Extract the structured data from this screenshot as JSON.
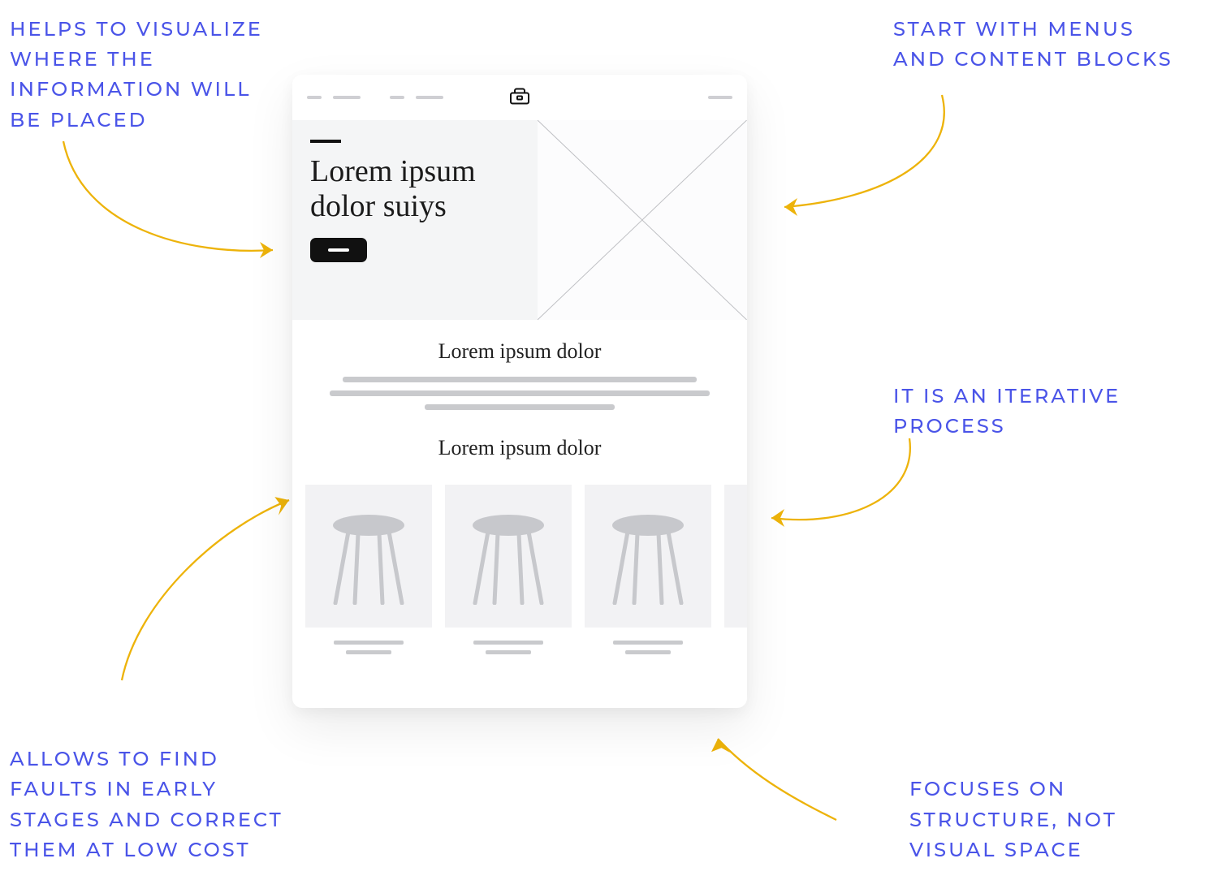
{
  "annotations": {
    "top_left": "HELPS TO VISUALIZE WHERE THE INFORMATION WILL BE PLACED",
    "top_right": "START WITH MENUS AND CONTENT BLOCKS",
    "mid_right": "IT IS AN ITERATIVE PROCESS",
    "bot_left": "ALLOWS TO FIND FAULTS IN EARLY STAGES AND CORRECT THEM AT LOW COST",
    "bot_right": "FOCUSES ON STRUCTURE, NOT VISUAL SPACE"
  },
  "wireframe": {
    "hero_heading": "Lorem ipsum dolor suiys",
    "section1_heading": "Lorem ipsum dolor",
    "section2_heading": "Lorem ipsum dolor"
  },
  "colors": {
    "annotation_text": "#4a54e8",
    "arrow": "#edb30a",
    "wireframe_bg": "#ffffff",
    "hero_bg": "#f4f5f6",
    "placeholder_gray": "#c9cacd"
  }
}
